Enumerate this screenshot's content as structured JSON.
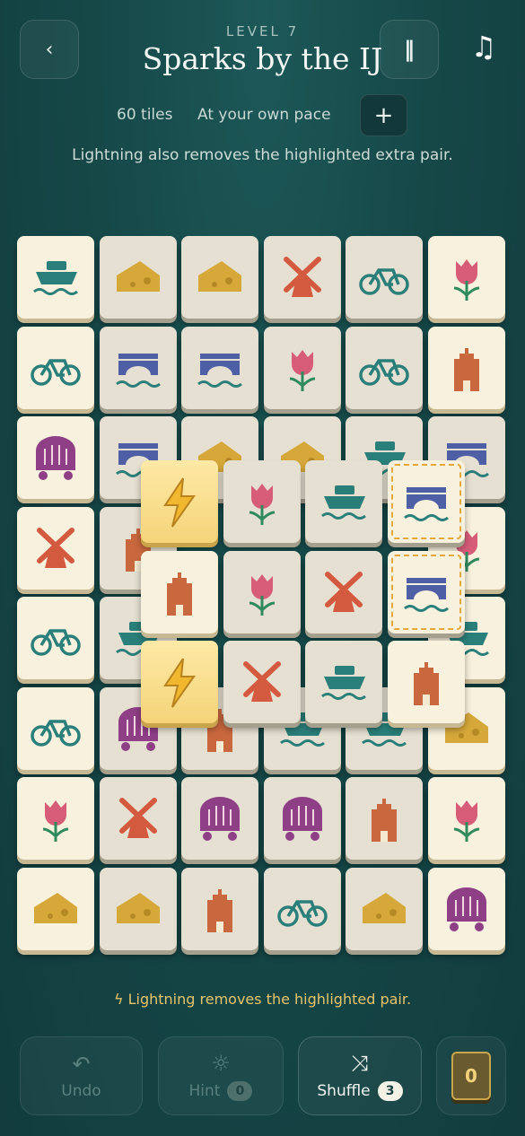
{
  "header": {
    "back_icon": "chevron-left-icon",
    "level_label": "LEVEL 7",
    "title": "Sparks by the IJ",
    "pause_icon": "pause-icon",
    "music_icon": "music-note-icon"
  },
  "info": {
    "tiles": "60 tiles",
    "pace": "At your own pace",
    "add_icon": "plus-icon"
  },
  "notice": "Lightning also removes the highlighted extra pair.",
  "board_bottom": [
    [
      "boat",
      "cheese",
      "cheese",
      "windmill",
      "bike",
      "tulip"
    ],
    [
      "bike",
      "bridge",
      "bridge",
      "tulip",
      "bike",
      "house"
    ],
    [
      "cart",
      "bridge",
      "cheese",
      "cheese",
      "boat",
      "bridge"
    ],
    [
      "windmill",
      "house",
      "",
      "",
      "",
      "tulip"
    ],
    [
      "bike",
      "boat",
      "",
      "",
      "",
      "boat"
    ],
    [
      "bike",
      "cart",
      "house",
      "boat",
      "boat",
      "cheese"
    ],
    [
      "tulip",
      "windmill",
      "cart",
      "cart",
      "house",
      "tulip"
    ],
    [
      "cheese",
      "cheese",
      "house",
      "bike",
      "cheese",
      "cart"
    ]
  ],
  "board_top": [
    [
      "bolt",
      "tulip",
      "boat",
      "bridge"
    ],
    [
      "house",
      "tulip",
      "windmill",
      "bridge"
    ],
    [
      "bolt",
      "windmill",
      "boat",
      "house"
    ]
  ],
  "hint_line": "ϟ Lightning removes the highlighted pair.",
  "toolbar": {
    "undo": {
      "label": "Undo",
      "icon": "undo-icon"
    },
    "hint": {
      "label": "Hint",
      "count": "0",
      "icon": "sun-icon"
    },
    "shuffle": {
      "label": "Shuffle",
      "count": "3",
      "icon": "shuffle-icon"
    },
    "coins": {
      "value": "0"
    }
  },
  "colors": {
    "teal": "#2b7f7a",
    "gold": "#d6a83a",
    "red": "#d45a3f",
    "blue": "#4f5fa6",
    "pink": "#d65c78",
    "purple": "#8e3f86",
    "brick": "#c9683e"
  }
}
